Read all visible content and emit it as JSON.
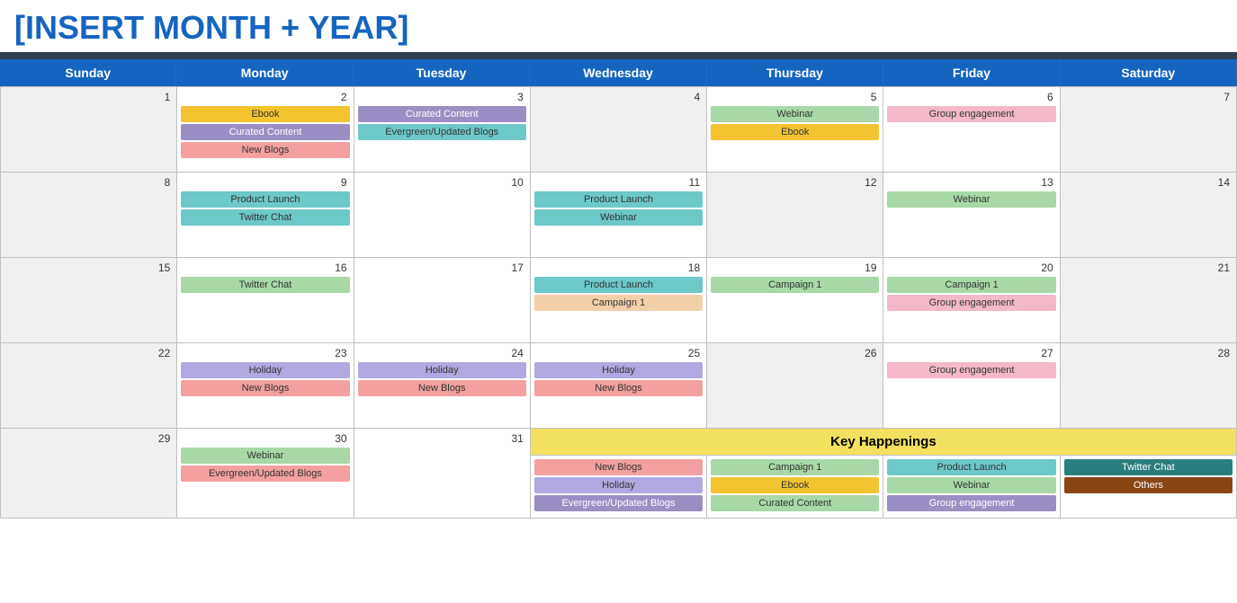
{
  "title": "[INSERT MONTH + YEAR]",
  "days_of_week": [
    "Sunday",
    "Monday",
    "Tuesday",
    "Wednesday",
    "Thursday",
    "Friday",
    "Saturday"
  ],
  "weeks": [
    {
      "cells": [
        {
          "num": "1",
          "gray": true,
          "events": []
        },
        {
          "num": "2",
          "gray": false,
          "events": [
            {
              "label": "Ebook",
              "style": "ev-orange"
            },
            {
              "label": "Curated Content",
              "style": "ev-purple"
            },
            {
              "label": "New Blogs",
              "style": "ev-salmon"
            }
          ]
        },
        {
          "num": "3",
          "gray": false,
          "events": [
            {
              "label": "Curated Content",
              "style": "ev-purple"
            },
            {
              "label": "Evergreen/Updated Blogs",
              "style": "ev-teal"
            }
          ]
        },
        {
          "num": "4",
          "gray": true,
          "events": []
        },
        {
          "num": "5",
          "gray": false,
          "events": [
            {
              "label": "Webinar",
              "style": "ev-green"
            },
            {
              "label": "Ebook",
              "style": "ev-orange"
            }
          ]
        },
        {
          "num": "6",
          "gray": false,
          "events": [
            {
              "label": "Group engagement",
              "style": "ev-pink"
            }
          ]
        },
        {
          "num": "7",
          "gray": true,
          "events": []
        }
      ]
    },
    {
      "cells": [
        {
          "num": "8",
          "gray": true,
          "events": []
        },
        {
          "num": "9",
          "gray": false,
          "events": [
            {
              "label": "Product Launch",
              "style": "ev-teal"
            },
            {
              "label": "Twitter Chat",
              "style": "ev-teal"
            }
          ]
        },
        {
          "num": "10",
          "gray": false,
          "events": []
        },
        {
          "num": "11",
          "gray": false,
          "events": [
            {
              "label": "Product Launch",
              "style": "ev-teal"
            },
            {
              "label": "Webinar",
              "style": "ev-teal"
            }
          ]
        },
        {
          "num": "12",
          "gray": true,
          "events": []
        },
        {
          "num": "13",
          "gray": false,
          "events": [
            {
              "label": "Webinar",
              "style": "ev-green"
            }
          ]
        },
        {
          "num": "14",
          "gray": true,
          "events": []
        }
      ]
    },
    {
      "cells": [
        {
          "num": "15",
          "gray": true,
          "events": []
        },
        {
          "num": "16",
          "gray": false,
          "events": [
            {
              "label": "Twitter Chat",
              "style": "ev-green"
            }
          ]
        },
        {
          "num": "17",
          "gray": false,
          "events": []
        },
        {
          "num": "18",
          "gray": false,
          "events": [
            {
              "label": "Product Launch",
              "style": "ev-teal"
            },
            {
              "label": "Campaign 1",
              "style": "ev-peach"
            }
          ]
        },
        {
          "num": "19",
          "gray": false,
          "events": [
            {
              "label": "Campaign 1",
              "style": "ev-green"
            }
          ]
        },
        {
          "num": "20",
          "gray": false,
          "events": [
            {
              "label": "Campaign 1",
              "style": "ev-green"
            },
            {
              "label": "Group engagement",
              "style": "ev-pink"
            }
          ]
        },
        {
          "num": "21",
          "gray": true,
          "events": []
        }
      ]
    },
    {
      "cells": [
        {
          "num": "22",
          "gray": true,
          "events": []
        },
        {
          "num": "23",
          "gray": false,
          "events": [
            {
              "label": "Holiday",
              "style": "ev-lavender"
            },
            {
              "label": "New Blogs",
              "style": "ev-salmon"
            }
          ]
        },
        {
          "num": "24",
          "gray": false,
          "events": [
            {
              "label": "Holiday",
              "style": "ev-lavender"
            },
            {
              "label": "New Blogs",
              "style": "ev-salmon"
            }
          ]
        },
        {
          "num": "25",
          "gray": false,
          "events": [
            {
              "label": "Holiday",
              "style": "ev-lavender"
            },
            {
              "label": "New Blogs",
              "style": "ev-salmon"
            }
          ]
        },
        {
          "num": "26",
          "gray": true,
          "events": []
        },
        {
          "num": "27",
          "gray": false,
          "events": [
            {
              "label": "Group engagement",
              "style": "ev-pink"
            }
          ]
        },
        {
          "num": "28",
          "gray": true,
          "events": []
        }
      ]
    }
  ],
  "last_week": {
    "left_cells": [
      {
        "num": "29",
        "gray": true,
        "events": []
      },
      {
        "num": "30",
        "gray": false,
        "events": [
          {
            "label": "Webinar",
            "style": "ev-green"
          },
          {
            "label": "Evergreen/Updated Blogs",
            "style": "ev-salmon"
          }
        ]
      },
      {
        "num": "31",
        "gray": false,
        "events": []
      }
    ],
    "key_happenings_label": "Key Happenings",
    "right_cells": [
      {
        "num": "",
        "gray": false,
        "events": [
          {
            "label": "New Blogs",
            "style": "ev-salmon"
          },
          {
            "label": "Holiday",
            "style": "ev-lavender"
          },
          {
            "label": "Evergreen/Updated Blogs",
            "style": "ev-purple"
          }
        ]
      },
      {
        "num": "",
        "gray": false,
        "events": [
          {
            "label": "Campaign 1",
            "style": "ev-green"
          },
          {
            "label": "Ebook",
            "style": "ev-orange"
          },
          {
            "label": "Curated Content",
            "style": "ev-green"
          }
        ]
      },
      {
        "num": "",
        "gray": false,
        "events": [
          {
            "label": "Product Launch",
            "style": "ev-teal"
          },
          {
            "label": "Webinar",
            "style": "ev-green"
          },
          {
            "label": "Group engagement",
            "style": "ev-purple"
          }
        ]
      },
      {
        "num": "",
        "gray": false,
        "events": [
          {
            "label": "Twitter Chat",
            "style": "ev-dark-teal"
          },
          {
            "label": "Others",
            "style": "ev-brown"
          }
        ]
      }
    ]
  },
  "colors": {
    "header_bg": "#1565c0",
    "title_color": "#1565c0",
    "key_happenings_bg": "#f4e060"
  }
}
